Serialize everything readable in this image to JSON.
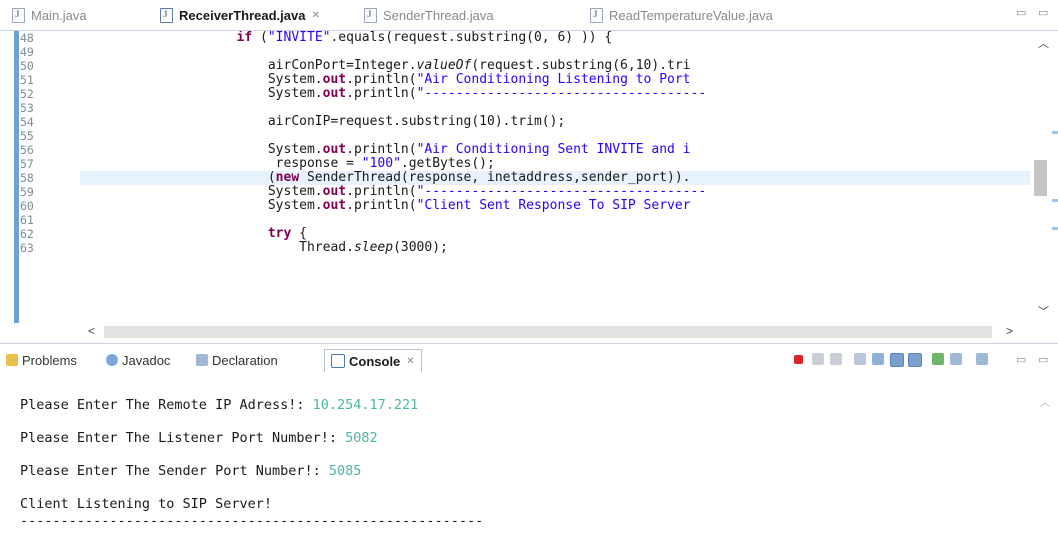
{
  "editor_tabs": [
    {
      "label": "Main.java",
      "active": false
    },
    {
      "label": "ReceiverThread.java",
      "active": true,
      "close": "✕"
    },
    {
      "label": "SenderThread.java",
      "active": false
    },
    {
      "label": "ReadTemperatureValue.java",
      "active": false
    }
  ],
  "window_controls": {
    "minimize": "▭",
    "maximize": "▭"
  },
  "line_numbers": [
    "48",
    "49",
    "50",
    "51",
    "52",
    "53",
    "54",
    "55",
    "56",
    "57",
    "58",
    "59",
    "60",
    "61",
    "62",
    "63"
  ],
  "code_lines": [
    "                    if (\"INVITE\".equals(request.substring(0, 6) )) {",
    "",
    "                        airConPort=Integer.valueOf(request.substring(6,10).tri",
    "                        System.out.println(\"Air Conditioning Listening to Port",
    "                        System.out.println(\"------------------------------------",
    "",
    "                        airConIP=request.substring(10).trim();",
    "",
    "                        System.out.println(\"Air Conditioning Sent INVITE and i",
    "                         response = \"100\".getBytes();",
    "                        (new SenderThread(response, inetaddress,sender_port)).",
    "                        System.out.println(\"------------------------------------",
    "                        System.out.println(\"Client Sent Response To SIP Server",
    "",
    "                        try {",
    "                            Thread.sleep(3000);"
  ],
  "highlighted_line": "55",
  "panel_tabs": [
    {
      "label": "Problems",
      "active": false
    },
    {
      "label": "Javadoc",
      "active": false
    },
    {
      "label": "Declaration",
      "active": false
    },
    {
      "label": "Console",
      "active": true,
      "close": "✕"
    }
  ],
  "console": {
    "lines": [
      {
        "prompt": "Please Enter The Remote IP Adress!: ",
        "input": "10.254.17.221"
      },
      {
        "prompt": "Please Enter The Listener Port Number!: ",
        "input": "5082"
      },
      {
        "prompt": "Please Enter The Sender Port Number!: ",
        "input": "5085"
      },
      {
        "prompt": "Client Listening to SIP Server!",
        "input": ""
      },
      {
        "prompt": "---------------------------------------------------------",
        "input": ""
      }
    ]
  },
  "colors": {
    "keyword": "#7f0055",
    "string": "#2a00ff",
    "console_input": "#4fb3a5",
    "current_line": "#e8f2fe",
    "terminate": "#d9232d"
  },
  "icons": {
    "editor_tab": "java-file-icon",
    "problems": "problems-icon",
    "javadoc": "javadoc-icon",
    "declaration": "declaration-icon",
    "console": "console-icon"
  }
}
